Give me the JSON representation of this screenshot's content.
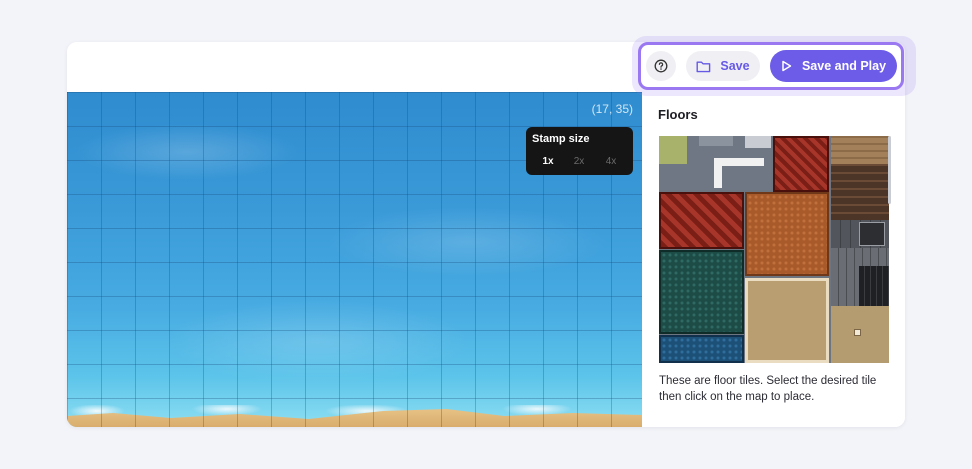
{
  "map": {
    "coordinates": "(17, 35)",
    "stamp": {
      "title": "Stamp size",
      "options": [
        "1x",
        "2x",
        "4x"
      ],
      "selected": "1x"
    }
  },
  "toolbar": {
    "help_icon": "question-circle-icon",
    "save_icon": "folder-icon",
    "save_label": "Save",
    "play_icon": "play-icon",
    "play_label": "Save and Play",
    "accent_color": "#6c5ce7",
    "highlight_color": "#9a78f2"
  },
  "panel": {
    "title": "Floors",
    "description": "These are floor tiles. Select the desired tile then click on the map to place."
  }
}
